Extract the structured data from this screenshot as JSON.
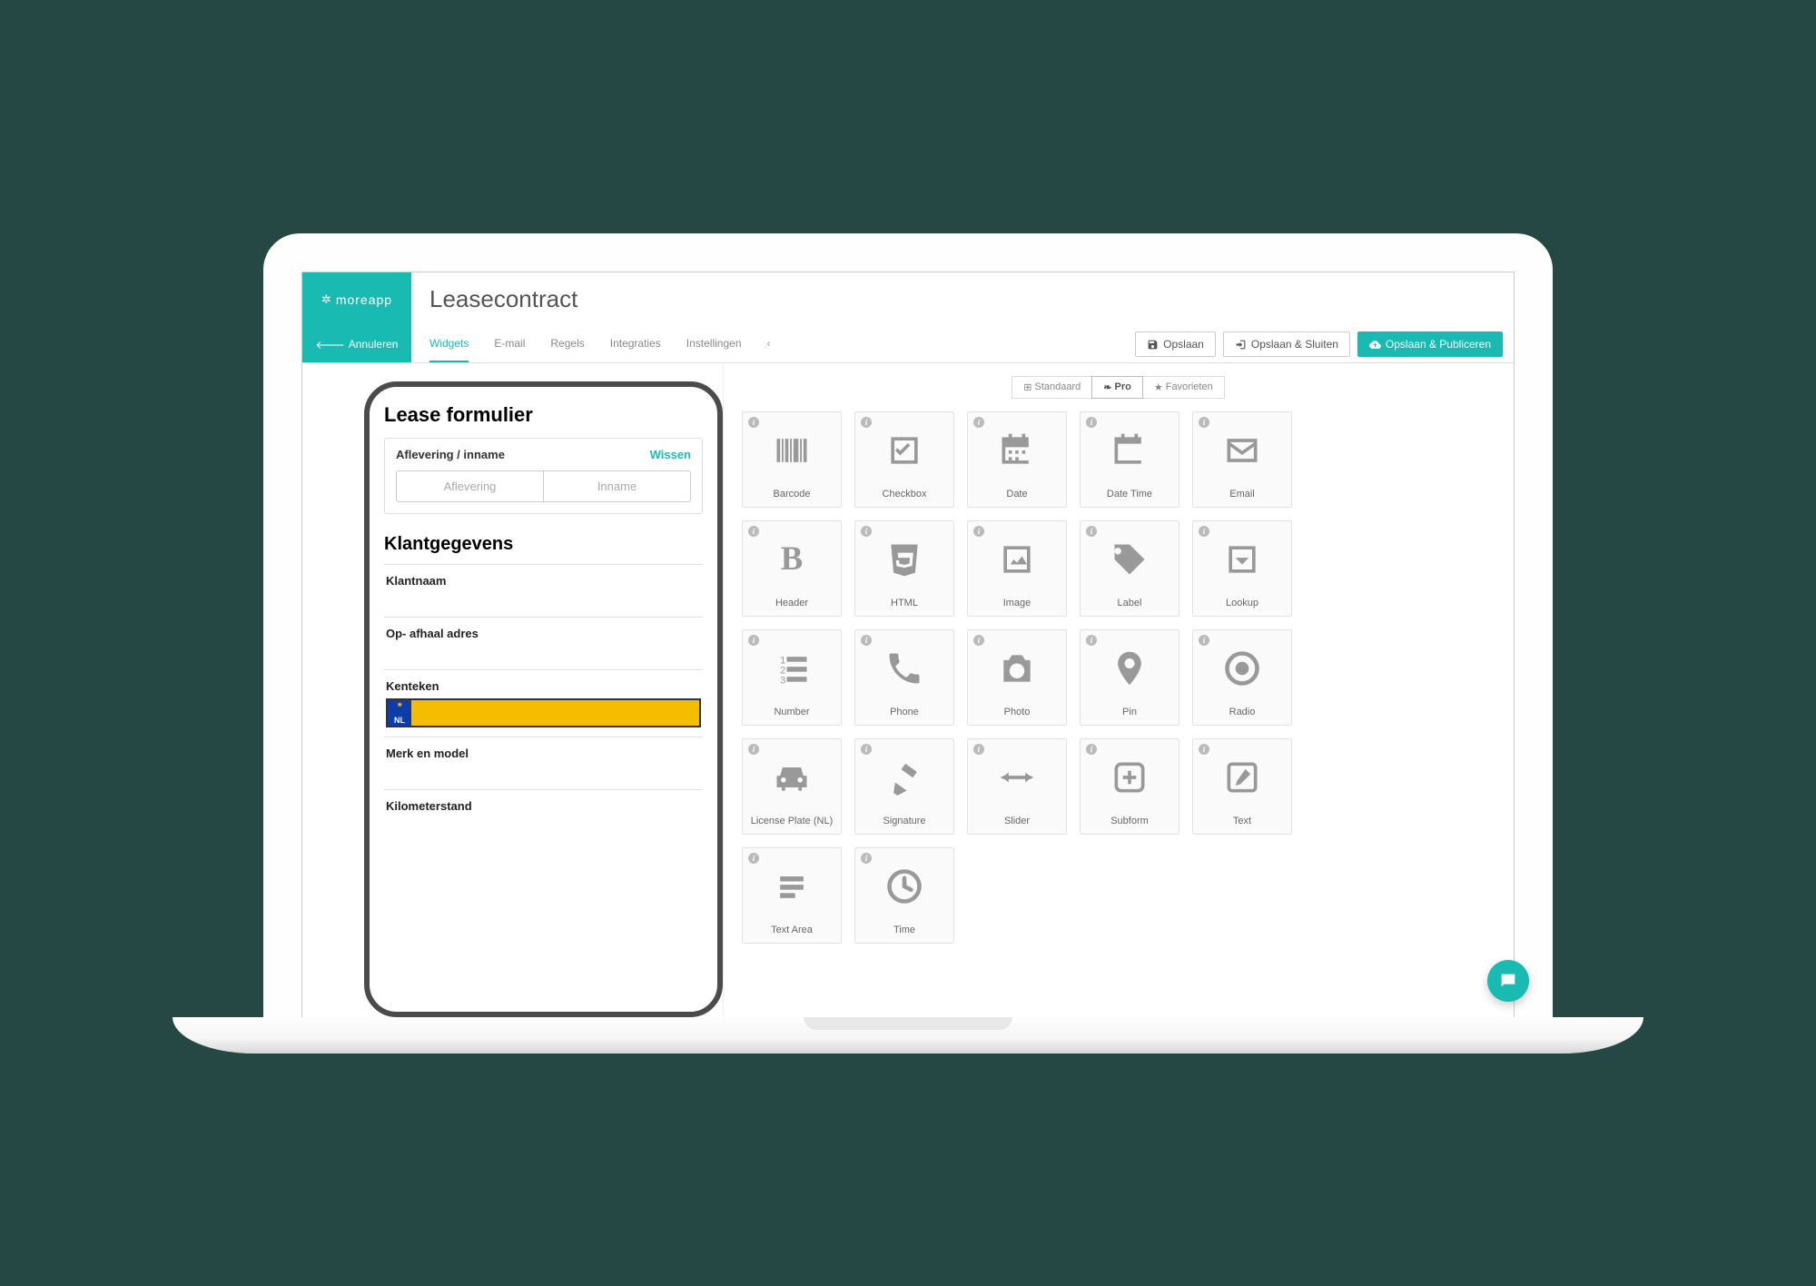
{
  "brand": "moreapp",
  "header": {
    "title": "Leasecontract",
    "cancel": "Annuleren"
  },
  "tabs": [
    "Widgets",
    "E-mail",
    "Regels",
    "Integraties",
    "Instellingen"
  ],
  "actions": {
    "save": "Opslaan",
    "save_close": "Opslaan & Sluiten",
    "save_publish": "Opslaan & Publiceren"
  },
  "preview": {
    "form_title": "Lease formulier",
    "delivery_card": {
      "label": "Aflevering / inname",
      "clear": "Wissen",
      "option_a": "Aflevering",
      "option_b": "Inname"
    },
    "section2": "Klantgegevens",
    "fields": {
      "klantnaam": "Klantnaam",
      "adres": "Op- afhaal adres",
      "kenteken": "Kenteken",
      "merk": "Merk en model",
      "km": "Kilometerstand"
    },
    "plate_country": "NL"
  },
  "categories": {
    "standard": "Standaard",
    "pro": "Pro",
    "fav": "Favorieten"
  },
  "widgets": [
    {
      "id": "barcode",
      "label": "Barcode"
    },
    {
      "id": "checkbox",
      "label": "Checkbox"
    },
    {
      "id": "date",
      "label": "Date"
    },
    {
      "id": "datetime",
      "label": "Date Time"
    },
    {
      "id": "email",
      "label": "Email"
    },
    {
      "id": "header",
      "label": "Header"
    },
    {
      "id": "html",
      "label": "HTML"
    },
    {
      "id": "image",
      "label": "Image"
    },
    {
      "id": "label",
      "label": "Label"
    },
    {
      "id": "lookup",
      "label": "Lookup"
    },
    {
      "id": "number",
      "label": "Number"
    },
    {
      "id": "phone",
      "label": "Phone"
    },
    {
      "id": "photo",
      "label": "Photo"
    },
    {
      "id": "pin",
      "label": "Pin"
    },
    {
      "id": "radio",
      "label": "Radio"
    },
    {
      "id": "licenseplate",
      "label": "License Plate (NL)"
    },
    {
      "id": "signature",
      "label": "Signature"
    },
    {
      "id": "slider",
      "label": "Slider"
    },
    {
      "id": "subform",
      "label": "Subform"
    },
    {
      "id": "text",
      "label": "Text"
    },
    {
      "id": "textarea",
      "label": "Text Area"
    },
    {
      "id": "time",
      "label": "Time"
    }
  ]
}
